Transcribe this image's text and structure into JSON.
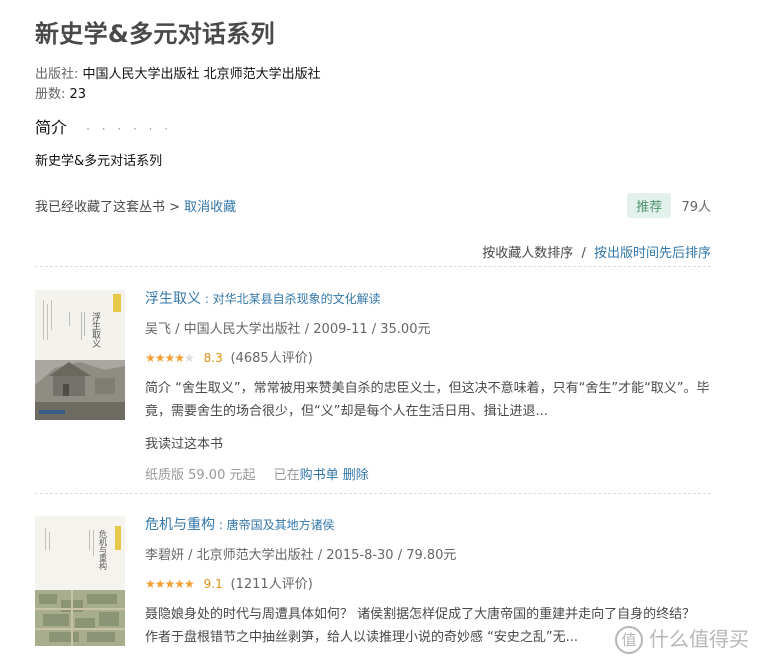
{
  "series": {
    "title": "新史学&多元对话系列",
    "publisher_label": "出版社:",
    "publisher_value": "中国人民大学出版社 北京师范大学出版社",
    "count_label": "册数:",
    "count_value": "23",
    "intro_heading": "简介",
    "intro_dots": "· · · · · ·",
    "intro_text": "新史学&多元对话系列",
    "collected_text": "我已经收藏了这套丛书 >",
    "uncollect_link": "取消收藏",
    "recommend_button": "推荐",
    "recommend_count": "79人"
  },
  "sort": {
    "by_collect": "按收藏人数排序",
    "separator": "/",
    "by_date": "按出版时间先后排序"
  },
  "books": [
    {
      "title_main": "浮生取义",
      "title_sub": " : 对华北某县自杀现象的文化解读",
      "pub_line": "吴飞 / 中国人民大学出版社 / 2009-11 / 35.00元",
      "stars_on": "★★★★",
      "stars_off": "★",
      "score": "8.3",
      "votes": "(4685人评价)",
      "desc": "简介 “舍生取义”，常常被用来赞美自杀的忠臣义士，但这决不意味着，只有“舍生”才能“取义”。毕竟，需要舍生的场合很少，但“义”却是每个人在生活日用、揖让进退...",
      "read": "我读过这本书",
      "paper_price": "纸质版 59.00 元起",
      "in_cart_prefix": "已在",
      "cart_link": "购书单",
      "delete_link": "删除",
      "cover_title": "浮生取义"
    },
    {
      "title_main": "危机与重构",
      "title_sub": " : 唐帝国及其地方诸侯",
      "pub_line": "李碧妍 / 北京师范大学出版社 / 2015-8-30 / 79.80元",
      "stars_on": "★★★★★",
      "stars_off": "",
      "score": "9.1",
      "votes": "(1211人评价)",
      "desc": "聂隐娘身处的时代与周遭具体如何？ 诸侯割据怎样促成了大唐帝国的重建并走向了自身的终结？ 作者于盘根错节之中抽丝剥笋，给人以读推理小说的奇妙感 “安史之乱”无...",
      "cover_title": "危机与重构"
    }
  ],
  "watermark": {
    "icon_glyph": "值",
    "text": "什么值得买"
  },
  "colors": {
    "link": "#3377aa",
    "title": "#494949",
    "star": "#f2a033",
    "score": "#e09015",
    "recommend_bg": "#e3f1ed",
    "recommend_fg": "#4f946e"
  }
}
